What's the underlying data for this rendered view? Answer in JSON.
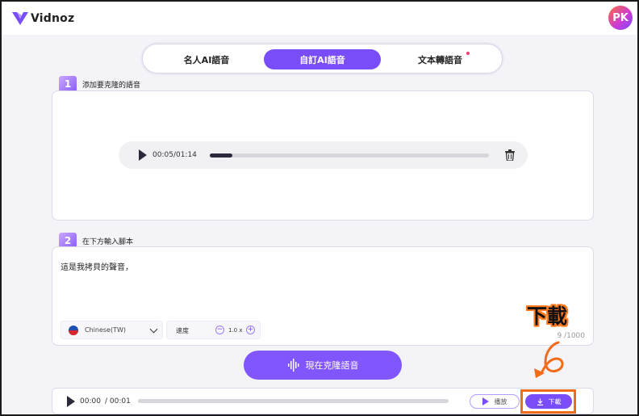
{
  "app": {
    "name": "Vidnoz",
    "avatar_initials": "PK"
  },
  "tabs": [
    {
      "label": "名人AI語音",
      "active": false,
      "has_dot": false
    },
    {
      "label": "自訂AI語音",
      "active": true,
      "has_dot": false
    },
    {
      "label": "文本轉語音",
      "active": false,
      "has_dot": true
    }
  ],
  "step1": {
    "number": "1",
    "label": "添加要克隆的語音"
  },
  "sample_player": {
    "current": "00:05",
    "total": "/01:14",
    "progress": 0.08
  },
  "step2": {
    "number": "2",
    "label": "在下方輸入腳本"
  },
  "script": {
    "text": "這是我拷貝的聲音，",
    "language": "Chinese(TW)",
    "speed_label": "速度",
    "speed_value": "1.0 x",
    "counter": "9 /1000"
  },
  "clone_button": {
    "label": "現在克隆語音"
  },
  "output_player": {
    "current": "00:00",
    "total": "/ 00:01",
    "progress": 0.0,
    "play_label": "播放",
    "download_label": "下載"
  },
  "annotation": {
    "text": "下載",
    "color": "#f26b17"
  },
  "colors": {
    "accent": "#7a4dfa"
  }
}
